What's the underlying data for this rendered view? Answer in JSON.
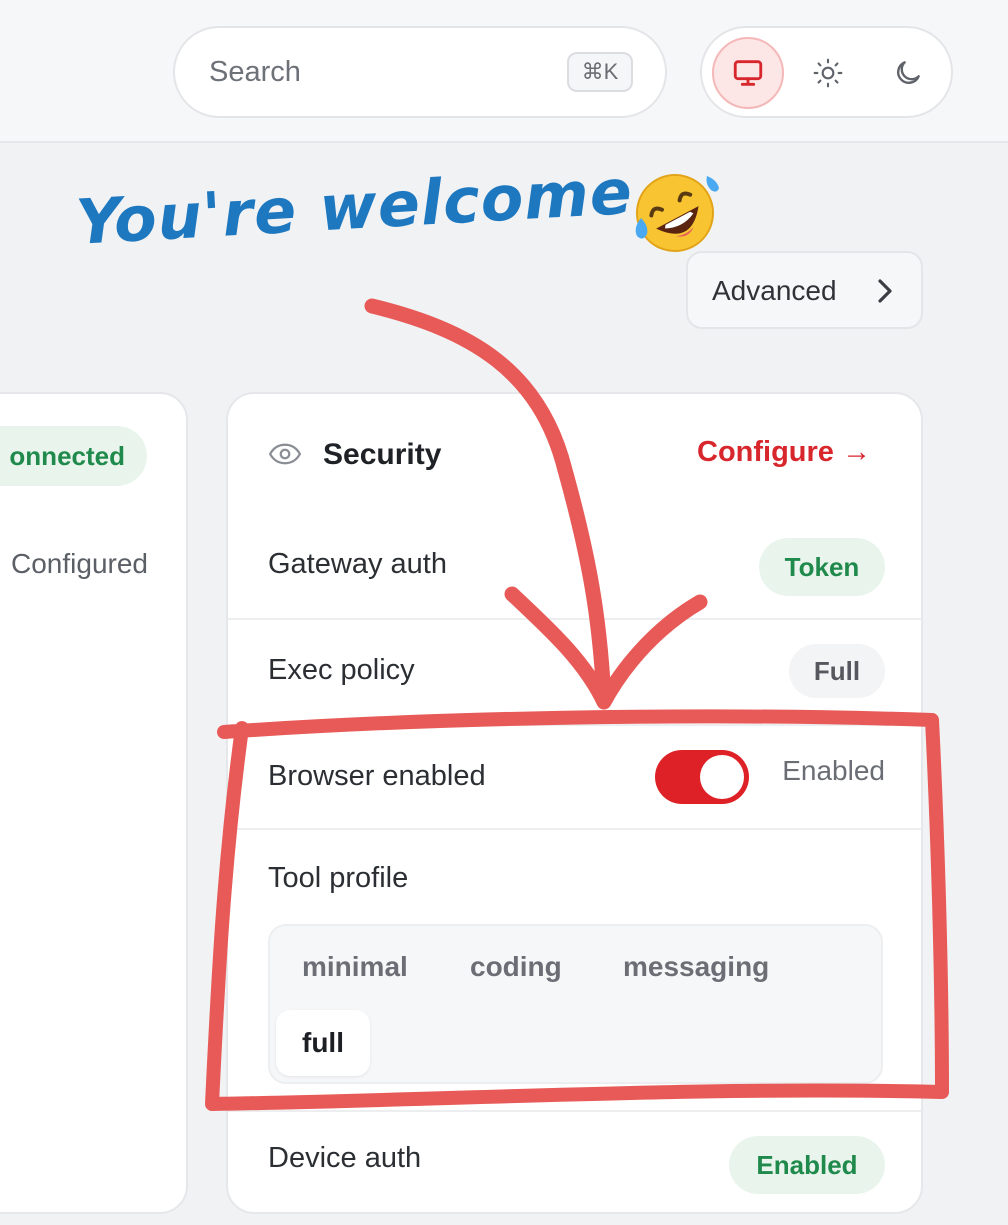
{
  "header": {
    "search": {
      "placeholder": "Search",
      "shortcut": "⌘K"
    },
    "theme_options": [
      {
        "icon": "monitor-icon",
        "active": true
      },
      {
        "icon": "sun-icon",
        "active": false
      },
      {
        "icon": "moon-icon",
        "active": false
      }
    ]
  },
  "advanced_button": {
    "label": "Advanced",
    "icon": "chevron-right-icon"
  },
  "left_card": {
    "status_badge": "onnected",
    "value": "Configured"
  },
  "security_card": {
    "title": "Security",
    "icon": "eye-icon",
    "configure_link": "Configure →",
    "rows": {
      "gateway_auth": {
        "label": "Gateway auth",
        "badge": "Token"
      },
      "exec_policy": {
        "label": "Exec policy",
        "badge": "Full"
      },
      "browser_enabled": {
        "label": "Browser enabled",
        "toggle_on": true,
        "status": "Enabled"
      },
      "tool_profile": {
        "label": "Tool profile",
        "options": [
          "minimal",
          "coding",
          "messaging",
          "full"
        ],
        "selected": "full"
      },
      "device_auth": {
        "label": "Device auth",
        "badge": "Enabled"
      }
    }
  },
  "annotation": {
    "caption": "You're welcome",
    "emoji": "rolling-on-floor-laughing-emoji",
    "color": "#e85a57"
  },
  "colors": {
    "accent_red": "#dd2126",
    "success_green": "#1f8a4c",
    "caption_blue": "#1d78c0"
  }
}
